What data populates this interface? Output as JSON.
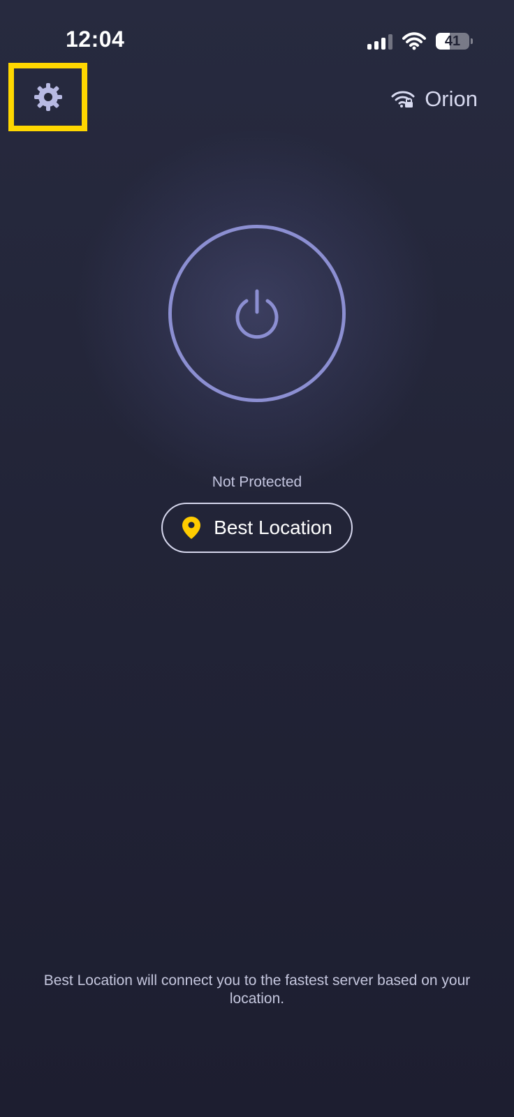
{
  "status_bar": {
    "time": "12:04",
    "battery_level": "41",
    "battery_fraction": 0.41,
    "icons": [
      "signal-icon",
      "wifi-icon",
      "battery-icon"
    ]
  },
  "header": {
    "settings_icon": "gear-icon",
    "network_icon": "wifi-lock-icon",
    "network_name": "Orion"
  },
  "main": {
    "power_icon": "power-icon",
    "status": "Not Protected",
    "location_icon": "location-pin-icon",
    "location_label": "Best Location"
  },
  "footer": {
    "note": "Best Location will connect you to the fastest server based on your location."
  },
  "colors": {
    "background": "#222436",
    "accent_yellow": "#ffd700",
    "power_ring": "#8c8fd2",
    "muted_text": "#c3c5df"
  }
}
